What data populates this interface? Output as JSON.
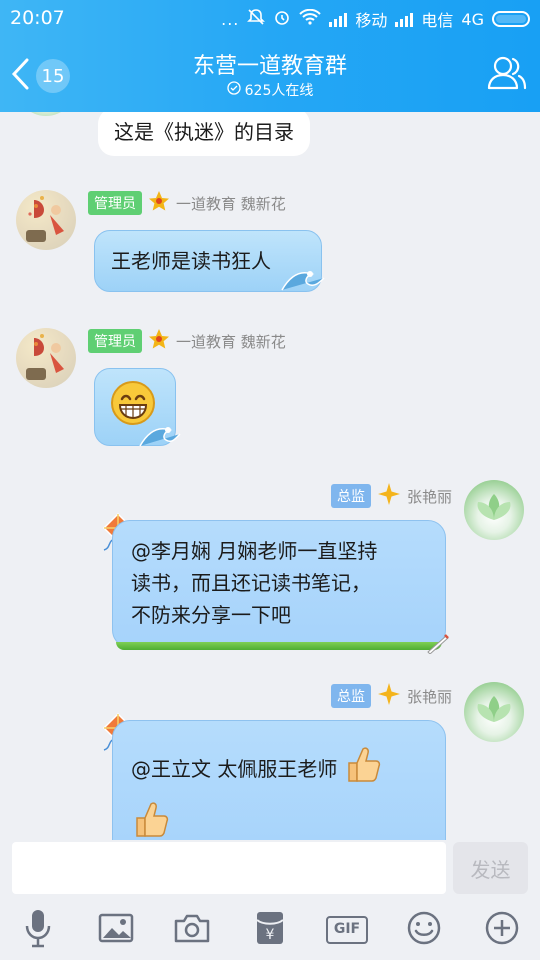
{
  "status_bar": {
    "time": "20:07",
    "dots": "...",
    "carrier1": "移动",
    "carrier2": "电信",
    "network": "4G"
  },
  "header": {
    "back_count": "15",
    "title": "东营一道教育群",
    "online": "625人在线"
  },
  "messages": [
    {
      "text": "这是《执迷》的目录"
    },
    {
      "role": "管理员",
      "sender": "一道教育 魏新花",
      "text": "王老师是读书狂人"
    },
    {
      "role": "管理员",
      "sender": "一道教育 魏新花",
      "text": "😁"
    },
    {
      "role": "总监",
      "sender": "张艳丽",
      "lines": [
        "@李月娴 月娴老师一直坚持",
        "读书，而且还记读书笔记，",
        "不防来分享一下吧"
      ]
    },
    {
      "role": "总监",
      "sender": "张艳丽",
      "line1": "@王立文 太佩服王老师"
    }
  ],
  "composer": {
    "placeholder": "",
    "send_label": "发送"
  },
  "toolbar": {
    "gif_label": "GIF"
  },
  "colors": {
    "header": "#25a7f5",
    "bubble_blue": "#a6d3fb",
    "admin_badge": "#5fcf73",
    "director_badge": "#7fb6ee"
  }
}
